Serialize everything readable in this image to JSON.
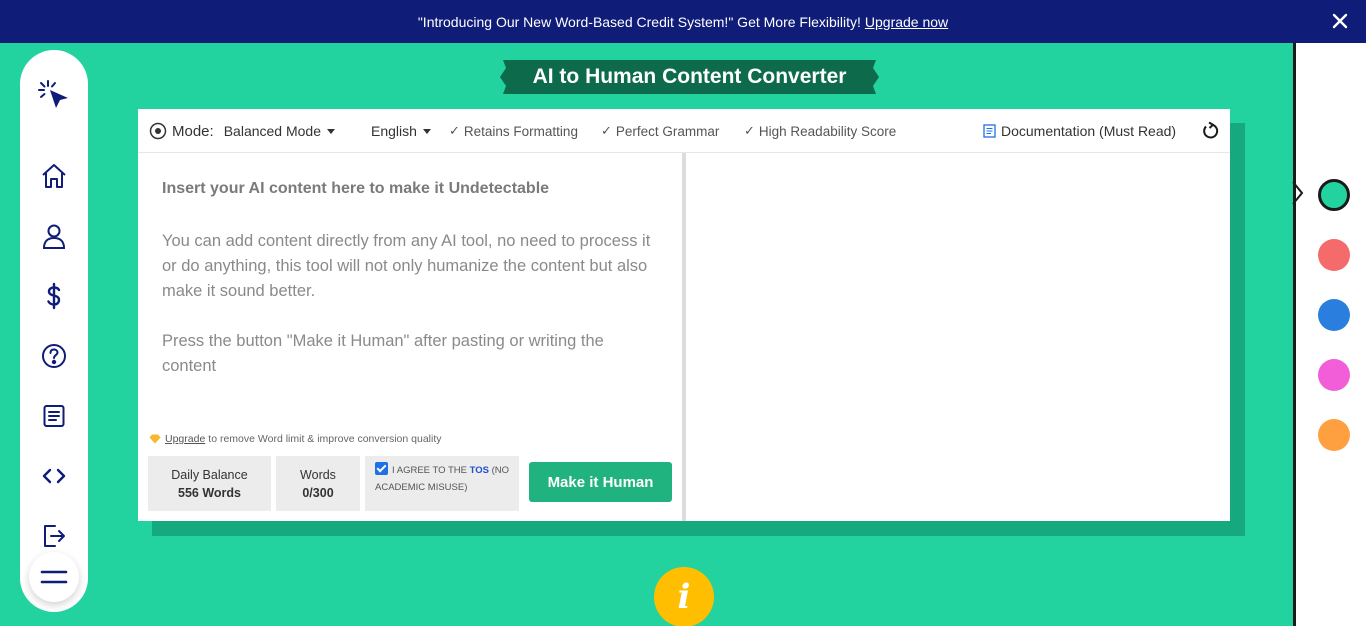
{
  "banner": {
    "message": "\"Introducing Our New Word-Based Credit System!\" Get More Flexibility!",
    "link": "Upgrade now"
  },
  "title": "AI to Human Content Converter",
  "toolbar": {
    "mode_label": "Mode:",
    "mode_value": "Balanced Mode",
    "language": "English",
    "features": [
      "Retains Formatting",
      "Perfect Grammar",
      "High Readability Score"
    ],
    "documentation": "Documentation (Must Read)"
  },
  "input": {
    "heading": "Insert your AI content here to make it Undetectable",
    "para1": "You can add content directly from any AI tool, no need to process it or do anything, this tool will not only humanize the content but also make it sound better.",
    "para2": "Press the button \"Make it Human\" after pasting or writing the content"
  },
  "upgrade_note": {
    "link": "Upgrade",
    "text": "to remove Word limit & improve conversion quality"
  },
  "stats": {
    "balance_label": "Daily Balance",
    "balance_value": "556 Words",
    "words_label": "Words",
    "words_value": "0/300"
  },
  "tos": {
    "prefix": "I AGREE TO THE",
    "link": "TOS",
    "suffix": "(NO ACADEMIC MISUSE)",
    "checked": true
  },
  "action_button": "Make it Human",
  "info_glyph": "i",
  "sidebar_icons": [
    "cursor-click-icon",
    "home-icon",
    "user-icon",
    "dollar-icon",
    "help-icon",
    "document-icon",
    "code-icon",
    "logout-icon",
    "menu-icon"
  ],
  "color_options": [
    {
      "name": "green",
      "color": "#22d3a0",
      "active": true
    },
    {
      "name": "red",
      "color": "#f56a6a",
      "active": false
    },
    {
      "name": "blue",
      "color": "#2a7fde",
      "active": false
    },
    {
      "name": "pink",
      "color": "#f25ed8",
      "active": false
    },
    {
      "name": "orange",
      "color": "#ffa040",
      "active": false
    }
  ],
  "colors": {
    "background": "#22d3a0",
    "banner": "#0f1c78",
    "title_bg": "#0d6b4c",
    "button": "#20b27f",
    "info": "#ffbf00"
  }
}
